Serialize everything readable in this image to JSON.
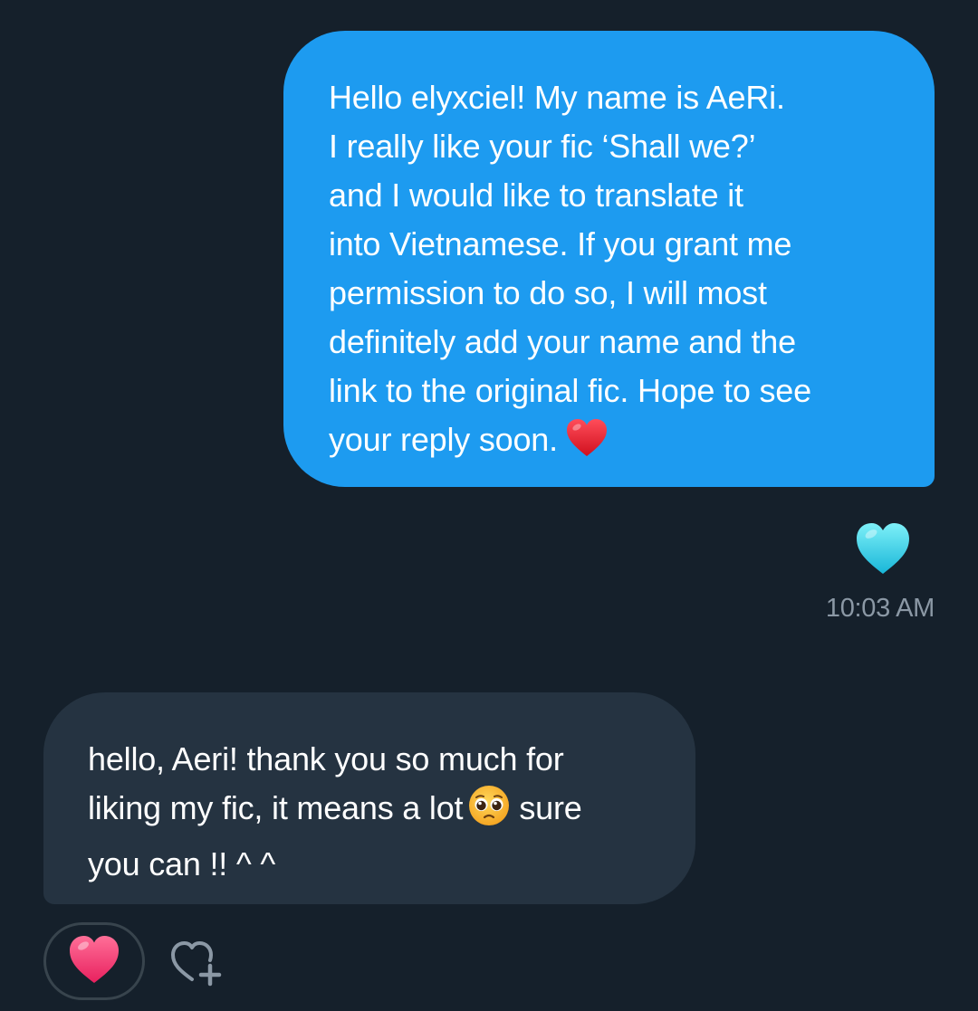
{
  "outgoing_message": {
    "lines": [
      "Hello elyxciel! My name is AeRi.",
      "I really like your fic ‘Shall we?’",
      "and I would like to translate it",
      "into Vietnamese.  If you grant me",
      "permission to do so, I will most",
      "definitely add your name and the",
      "link to the original fic. Hope to see",
      "your reply soon."
    ],
    "emoji": "red-heart-icon",
    "reaction": "light-blue-heart-icon",
    "timestamp": "10:03 AM"
  },
  "incoming_message": {
    "line1": "hello, Aeri! thank you so much for",
    "line2_before": "liking my fic, it means a lot",
    "line2_emoji": "pleading-face-icon",
    "line2_after": "sure",
    "line3": "you can !!  ^ ^",
    "reaction": "pink-heart-icon",
    "add_reaction_icon": "add-reaction-icon"
  },
  "colors": {
    "background": "#15202b",
    "outgoing_bubble": "#1d9bf0",
    "incoming_bubble": "#253341",
    "timestamp_text": "#8b98a5",
    "reaction_border": "#38444d"
  }
}
